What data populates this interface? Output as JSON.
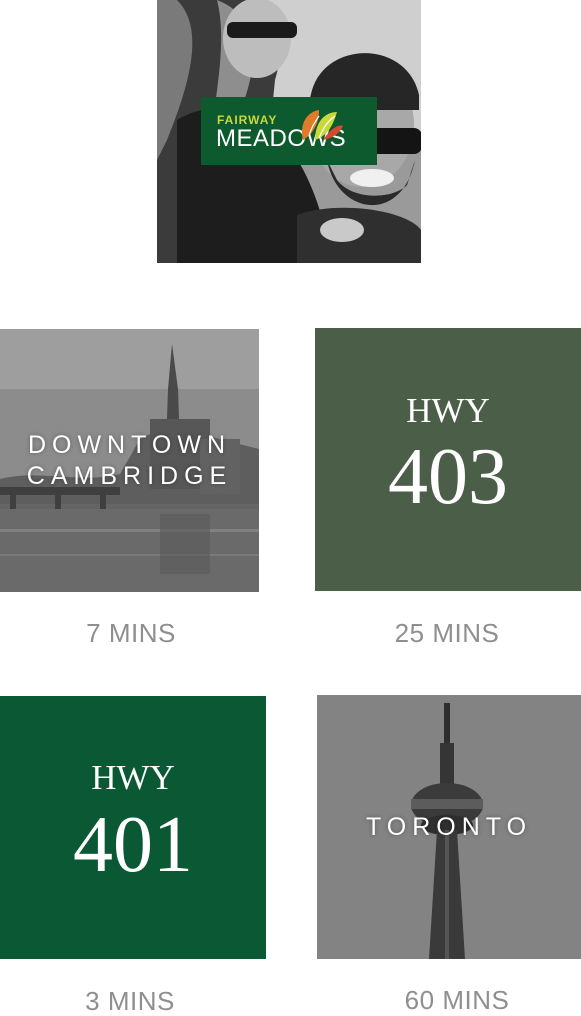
{
  "hero": {
    "logo_line1": "FAIRWAY",
    "logo_line2": "MEADOWS",
    "logo_bg": "#0d5a2f",
    "logo_accent": "#c8d93a"
  },
  "tiles": [
    {
      "name": "downtown-cambridge",
      "label_line1": "DOWNTOWN",
      "label_line2": "CAMBRIDGE",
      "time": "7 MINS",
      "style": "grayscale-photo"
    },
    {
      "name": "hwy-403",
      "prefix": "HWY",
      "number": "403",
      "time": "25 MINS",
      "bg": "#4b5e47"
    },
    {
      "name": "hwy-401",
      "prefix": "HWY",
      "number": "401",
      "time": "3 MINS",
      "bg": "#0b5934"
    },
    {
      "name": "toronto",
      "label": "TORONTO",
      "time": "60 MINS",
      "style": "grayscale-photo"
    }
  ],
  "colors": {
    "caption": "#8f8f8f",
    "text_on_tile": "#ffffff"
  }
}
